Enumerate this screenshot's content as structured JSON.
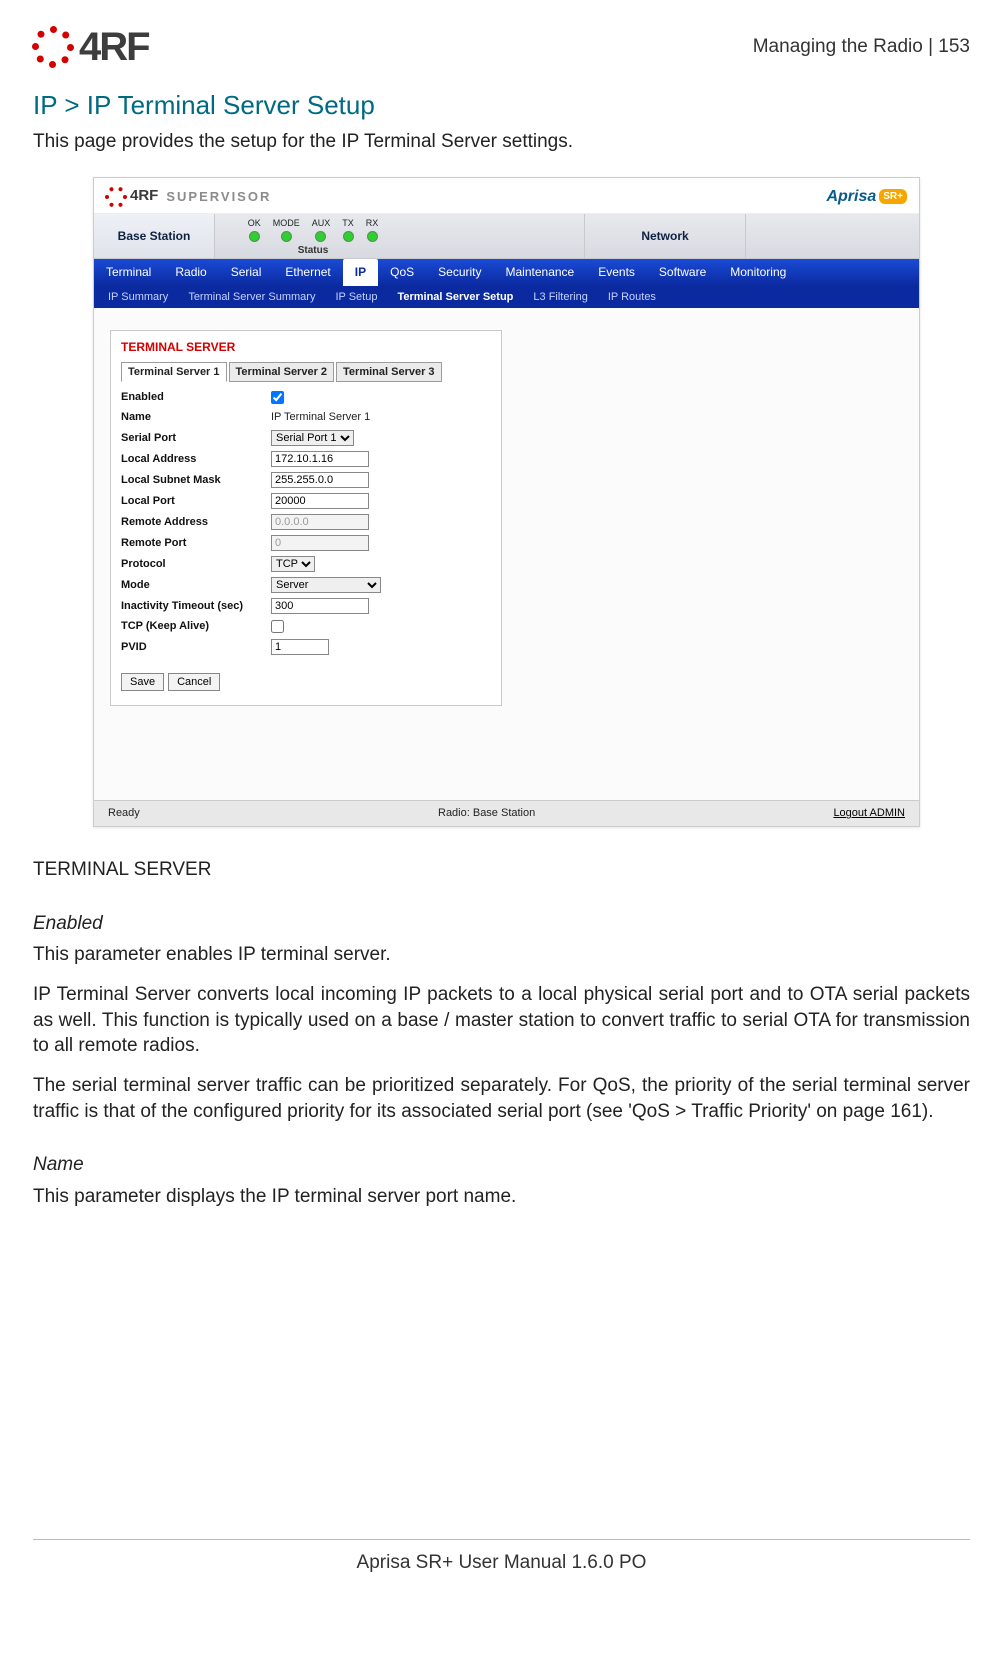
{
  "header": {
    "right_text": "Managing the Radio  |  153",
    "logo_text": "4RF"
  },
  "doc": {
    "section_title_text": "IP > IP Terminal Server Setup",
    "intro_text": "This page provides the setup for the IP Terminal Server settings.",
    "h2_text": "TERMINAL SERVER",
    "enabled_h": "Enabled",
    "enabled_p1": "This parameter enables IP terminal server.",
    "enabled_p2": "IP Terminal Server converts local incoming IP packets to a local physical serial port and to OTA serial packets as well. This function is typically used on a base / master station to convert traffic to serial OTA for transmission to all remote radios.",
    "enabled_p3": "The serial terminal server traffic can be prioritized separately. For QoS, the priority of the serial terminal server traffic is that of the configured priority for its associated serial port (see 'QoS > Traffic Priority' on page 161).",
    "name_h": "Name",
    "name_p": "This parameter displays the IP terminal server port name.",
    "footer_text": "Aprisa SR+ User Manual 1.6.0 PO"
  },
  "app": {
    "supervisor_text": "SUPERVISOR",
    "supervisor_brand": "4RF",
    "aprisa_text": "Aprisa",
    "aprisa_pill": "SR+",
    "device_tab": "Base Station",
    "network_tab": "Network",
    "leds": {
      "labels": [
        "OK",
        "MODE",
        "AUX",
        "TX",
        "RX"
      ],
      "caption": "Status"
    },
    "main_nav": {
      "items": [
        "Terminal",
        "Radio",
        "Serial",
        "Ethernet",
        "IP",
        "QoS",
        "Security",
        "Maintenance",
        "Events",
        "Software",
        "Monitoring"
      ],
      "active_index": 4
    },
    "sub_nav": {
      "items": [
        "IP Summary",
        "Terminal Server Summary",
        "IP Setup",
        "Terminal Server Setup",
        "L3 Filtering",
        "IP Routes"
      ],
      "active_index": 3
    },
    "panel_title": "TERMINAL SERVER",
    "inner_tabs": {
      "items": [
        "Terminal Server 1",
        "Terminal Server 2",
        "Terminal Server 3"
      ],
      "active_index": 0
    },
    "fields": {
      "enabled": {
        "label": "Enabled",
        "checked": true
      },
      "name": {
        "label": "Name",
        "value": "IP Terminal Server 1"
      },
      "serial_port": {
        "label": "Serial Port",
        "value": "Serial Port 1"
      },
      "local_address": {
        "label": "Local Address",
        "value": "172.10.1.16"
      },
      "local_subnet": {
        "label": "Local Subnet Mask",
        "value": "255.255.0.0"
      },
      "local_port": {
        "label": "Local Port",
        "value": "20000"
      },
      "remote_address": {
        "label": "Remote Address",
        "value": "0.0.0.0"
      },
      "remote_port": {
        "label": "Remote Port",
        "value": "0"
      },
      "protocol": {
        "label": "Protocol",
        "value": "TCP"
      },
      "mode": {
        "label": "Mode",
        "value": "Server"
      },
      "inactivity": {
        "label": "Inactivity Timeout (sec)",
        "value": "300"
      },
      "tcp_keep": {
        "label": "TCP (Keep Alive)",
        "checked": false
      },
      "pvid": {
        "label": "PVID",
        "value": "1"
      }
    },
    "buttons": {
      "save": "Save",
      "cancel": "Cancel"
    },
    "status_bar": {
      "ready": "Ready",
      "center": "Radio: Base Station",
      "logout_label": "Logout",
      "logout_user": "ADMIN"
    }
  }
}
